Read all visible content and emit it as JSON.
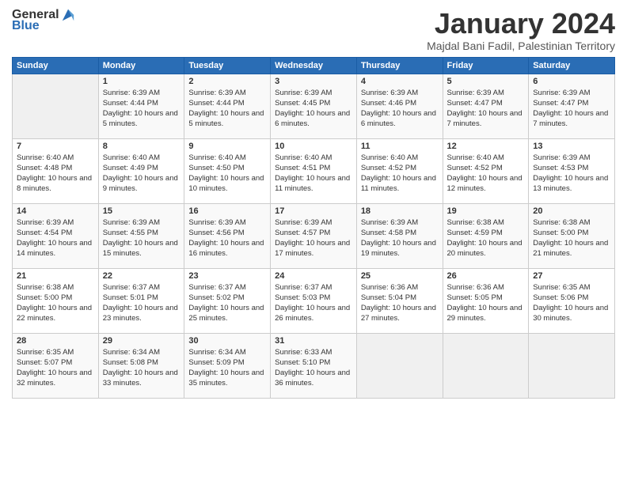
{
  "logo": {
    "general": "General",
    "blue": "Blue"
  },
  "header": {
    "month": "January 2024",
    "location": "Majdal Bani Fadil, Palestinian Territory"
  },
  "weekdays": [
    "Sunday",
    "Monday",
    "Tuesday",
    "Wednesday",
    "Thursday",
    "Friday",
    "Saturday"
  ],
  "weeks": [
    [
      {
        "day": "",
        "sunrise": "",
        "sunset": "",
        "daylight": ""
      },
      {
        "day": "1",
        "sunrise": "Sunrise: 6:39 AM",
        "sunset": "Sunset: 4:44 PM",
        "daylight": "Daylight: 10 hours and 5 minutes."
      },
      {
        "day": "2",
        "sunrise": "Sunrise: 6:39 AM",
        "sunset": "Sunset: 4:44 PM",
        "daylight": "Daylight: 10 hours and 5 minutes."
      },
      {
        "day": "3",
        "sunrise": "Sunrise: 6:39 AM",
        "sunset": "Sunset: 4:45 PM",
        "daylight": "Daylight: 10 hours and 6 minutes."
      },
      {
        "day": "4",
        "sunrise": "Sunrise: 6:39 AM",
        "sunset": "Sunset: 4:46 PM",
        "daylight": "Daylight: 10 hours and 6 minutes."
      },
      {
        "day": "5",
        "sunrise": "Sunrise: 6:39 AM",
        "sunset": "Sunset: 4:47 PM",
        "daylight": "Daylight: 10 hours and 7 minutes."
      },
      {
        "day": "6",
        "sunrise": "Sunrise: 6:39 AM",
        "sunset": "Sunset: 4:47 PM",
        "daylight": "Daylight: 10 hours and 7 minutes."
      }
    ],
    [
      {
        "day": "7",
        "sunrise": "Sunrise: 6:40 AM",
        "sunset": "Sunset: 4:48 PM",
        "daylight": "Daylight: 10 hours and 8 minutes."
      },
      {
        "day": "8",
        "sunrise": "Sunrise: 6:40 AM",
        "sunset": "Sunset: 4:49 PM",
        "daylight": "Daylight: 10 hours and 9 minutes."
      },
      {
        "day": "9",
        "sunrise": "Sunrise: 6:40 AM",
        "sunset": "Sunset: 4:50 PM",
        "daylight": "Daylight: 10 hours and 10 minutes."
      },
      {
        "day": "10",
        "sunrise": "Sunrise: 6:40 AM",
        "sunset": "Sunset: 4:51 PM",
        "daylight": "Daylight: 10 hours and 11 minutes."
      },
      {
        "day": "11",
        "sunrise": "Sunrise: 6:40 AM",
        "sunset": "Sunset: 4:52 PM",
        "daylight": "Daylight: 10 hours and 11 minutes."
      },
      {
        "day": "12",
        "sunrise": "Sunrise: 6:40 AM",
        "sunset": "Sunset: 4:52 PM",
        "daylight": "Daylight: 10 hours and 12 minutes."
      },
      {
        "day": "13",
        "sunrise": "Sunrise: 6:39 AM",
        "sunset": "Sunset: 4:53 PM",
        "daylight": "Daylight: 10 hours and 13 minutes."
      }
    ],
    [
      {
        "day": "14",
        "sunrise": "Sunrise: 6:39 AM",
        "sunset": "Sunset: 4:54 PM",
        "daylight": "Daylight: 10 hours and 14 minutes."
      },
      {
        "day": "15",
        "sunrise": "Sunrise: 6:39 AM",
        "sunset": "Sunset: 4:55 PM",
        "daylight": "Daylight: 10 hours and 15 minutes."
      },
      {
        "day": "16",
        "sunrise": "Sunrise: 6:39 AM",
        "sunset": "Sunset: 4:56 PM",
        "daylight": "Daylight: 10 hours and 16 minutes."
      },
      {
        "day": "17",
        "sunrise": "Sunrise: 6:39 AM",
        "sunset": "Sunset: 4:57 PM",
        "daylight": "Daylight: 10 hours and 17 minutes."
      },
      {
        "day": "18",
        "sunrise": "Sunrise: 6:39 AM",
        "sunset": "Sunset: 4:58 PM",
        "daylight": "Daylight: 10 hours and 19 minutes."
      },
      {
        "day": "19",
        "sunrise": "Sunrise: 6:38 AM",
        "sunset": "Sunset: 4:59 PM",
        "daylight": "Daylight: 10 hours and 20 minutes."
      },
      {
        "day": "20",
        "sunrise": "Sunrise: 6:38 AM",
        "sunset": "Sunset: 5:00 PM",
        "daylight": "Daylight: 10 hours and 21 minutes."
      }
    ],
    [
      {
        "day": "21",
        "sunrise": "Sunrise: 6:38 AM",
        "sunset": "Sunset: 5:00 PM",
        "daylight": "Daylight: 10 hours and 22 minutes."
      },
      {
        "day": "22",
        "sunrise": "Sunrise: 6:37 AM",
        "sunset": "Sunset: 5:01 PM",
        "daylight": "Daylight: 10 hours and 23 minutes."
      },
      {
        "day": "23",
        "sunrise": "Sunrise: 6:37 AM",
        "sunset": "Sunset: 5:02 PM",
        "daylight": "Daylight: 10 hours and 25 minutes."
      },
      {
        "day": "24",
        "sunrise": "Sunrise: 6:37 AM",
        "sunset": "Sunset: 5:03 PM",
        "daylight": "Daylight: 10 hours and 26 minutes."
      },
      {
        "day": "25",
        "sunrise": "Sunrise: 6:36 AM",
        "sunset": "Sunset: 5:04 PM",
        "daylight": "Daylight: 10 hours and 27 minutes."
      },
      {
        "day": "26",
        "sunrise": "Sunrise: 6:36 AM",
        "sunset": "Sunset: 5:05 PM",
        "daylight": "Daylight: 10 hours and 29 minutes."
      },
      {
        "day": "27",
        "sunrise": "Sunrise: 6:35 AM",
        "sunset": "Sunset: 5:06 PM",
        "daylight": "Daylight: 10 hours and 30 minutes."
      }
    ],
    [
      {
        "day": "28",
        "sunrise": "Sunrise: 6:35 AM",
        "sunset": "Sunset: 5:07 PM",
        "daylight": "Daylight: 10 hours and 32 minutes."
      },
      {
        "day": "29",
        "sunrise": "Sunrise: 6:34 AM",
        "sunset": "Sunset: 5:08 PM",
        "daylight": "Daylight: 10 hours and 33 minutes."
      },
      {
        "day": "30",
        "sunrise": "Sunrise: 6:34 AM",
        "sunset": "Sunset: 5:09 PM",
        "daylight": "Daylight: 10 hours and 35 minutes."
      },
      {
        "day": "31",
        "sunrise": "Sunrise: 6:33 AM",
        "sunset": "Sunset: 5:10 PM",
        "daylight": "Daylight: 10 hours and 36 minutes."
      },
      {
        "day": "",
        "sunrise": "",
        "sunset": "",
        "daylight": ""
      },
      {
        "day": "",
        "sunrise": "",
        "sunset": "",
        "daylight": ""
      },
      {
        "day": "",
        "sunrise": "",
        "sunset": "",
        "daylight": ""
      }
    ]
  ]
}
